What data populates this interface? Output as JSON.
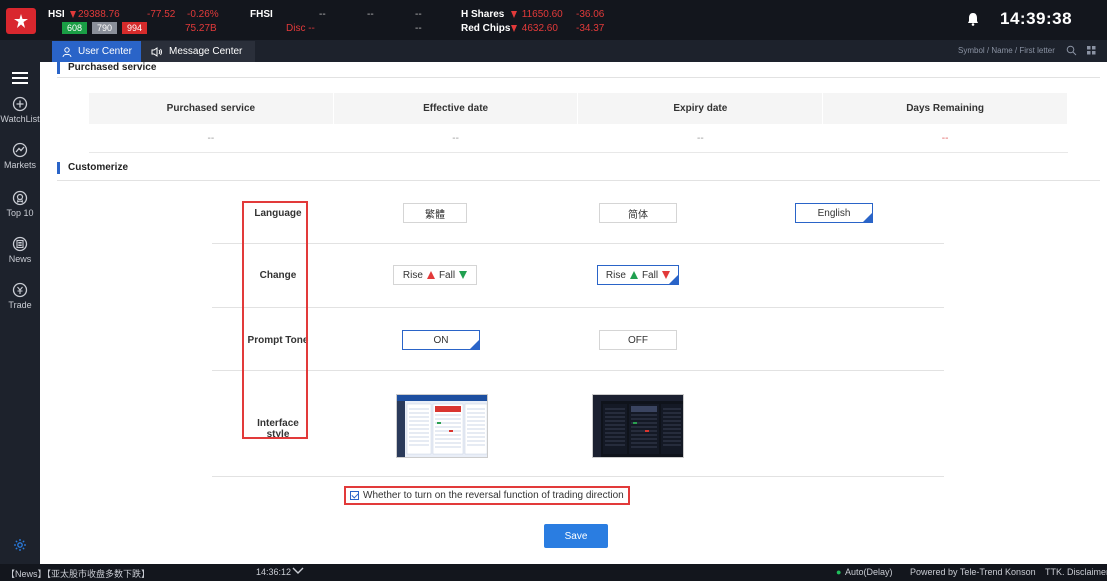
{
  "topbar": {
    "hsi": {
      "name": "HSI",
      "value": "29388.76",
      "change": "-77.52",
      "pct": "-0.26%",
      "turnover": "75.27B",
      "up": "608",
      "flat": "790",
      "down": "994"
    },
    "fhsi": {
      "name": "FHSI",
      "v1": "--",
      "v2": "--",
      "disc": "Disc --"
    },
    "h_shares": {
      "name": "H Shares",
      "value": "11650.60",
      "change": "-36.06"
    },
    "red_chips": {
      "name": "Red Chips",
      "value": "4632.60",
      "change": "-34.37"
    },
    "dashes": [
      "--",
      "--",
      "--"
    ],
    "clock": "14:39:38"
  },
  "subbar": {
    "tabs": [
      {
        "label": "User Center"
      },
      {
        "label": "Message Center"
      }
    ],
    "search_placeholder": "Symbol / Name / First letter"
  },
  "sidebar": {
    "items": [
      {
        "label": "WatchList",
        "icon": "plus-circle-icon"
      },
      {
        "label": "Markets",
        "icon": "chart-circle-icon"
      },
      {
        "label": "Top 10",
        "icon": "award-icon"
      },
      {
        "label": "News",
        "icon": "news-icon"
      },
      {
        "label": "Trade",
        "icon": "trade-icon"
      }
    ]
  },
  "purchased": {
    "title": "Purchased service",
    "headers": [
      "Purchased service",
      "Effective date",
      "Expiry date",
      "Days Remaining"
    ],
    "row": [
      "--",
      "--",
      "--",
      "--"
    ]
  },
  "customize": {
    "title": "Customerize",
    "rows": {
      "language": {
        "label": "Language",
        "options": [
          "繁體",
          "简体",
          "English"
        ]
      },
      "change": {
        "label": "Change",
        "rise": "Rise",
        "fall": "Fall"
      },
      "prompt": {
        "label": "Prompt Tone",
        "options": [
          "ON",
          "OFF"
        ]
      },
      "style": {
        "label": "Interface style"
      }
    },
    "checkbox_label": "Whether to turn on the reversal function of trading direction",
    "save": "Save"
  },
  "bottombar": {
    "news": "【News】【亚太股市收盘多数下跌】",
    "time": "14:36:12",
    "status": "Auto(Delay)",
    "powered": "Powered by Tele-Trend Konson",
    "disclaimer": "TTK. Disclaimer"
  },
  "colors": {
    "accent": "#2a64c8",
    "up": "#20c05c",
    "down": "#e23a3a",
    "highlight_box": "#e23a3a"
  }
}
